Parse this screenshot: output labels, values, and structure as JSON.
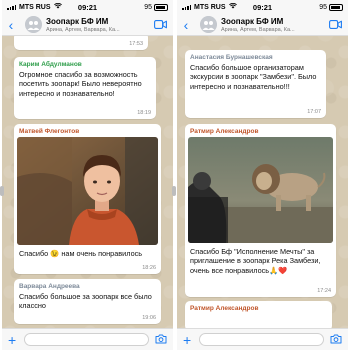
{
  "status_bar": {
    "left": {
      "carrier": "MTS RUS",
      "time": "09:21",
      "battery": "95"
    },
    "right": {
      "carrier": "MTS RUS",
      "time": "09:21",
      "battery": "95"
    }
  },
  "header": {
    "left": {
      "title": "Зоопарк БФ ИМ",
      "subtitle": "Арина, Артем, Варвара, Ка..."
    },
    "right": {
      "title": "Зоопарк БФ ИМ",
      "subtitle": "Арина, Артем, Варвара, Ка..."
    }
  },
  "colors": {
    "accent": "#1d7cf2",
    "green_sender": "#2f9e4b",
    "brown_sender": "#c0552a",
    "gray_sender": "#7d8a99"
  },
  "left_chat": {
    "top_time": "17:53",
    "messages": [
      {
        "sender": "Карим Абдулманов",
        "text": "Огромное спасибо за возможность посетить зоопарк! Было невероятно интересно и познавательно!",
        "time": "18:19"
      },
      {
        "sender": "Матвей Флегонтов",
        "text": "Спасибо 😉 нам очень понравилось",
        "time": "18:26"
      },
      {
        "sender": "Варвара Андреева",
        "text": "Спасибо большое за зоопарк все было классно",
        "time": "19:06"
      }
    ]
  },
  "right_chat": {
    "messages": [
      {
        "sender": "Анастасия Бурнашевская",
        "text": "Спасибо большое организаторам экскурсии в зоопарк \"Замбези\". Было интересно и познавательно!!!",
        "time": "17:07"
      },
      {
        "sender": "Ратмир Александров",
        "text": "Спасибо Бф \"Исполнение Мечты\" за приглашение в зоопарк Река Замбези, очень все понравилось🙏❤️",
        "time": "17:24"
      },
      {
        "sender": "Ратмир Александров"
      }
    ]
  },
  "icons": {
    "back": "‹",
    "plus": "+"
  }
}
